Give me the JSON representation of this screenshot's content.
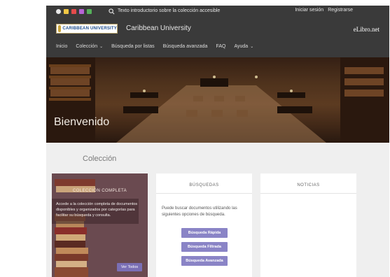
{
  "topbar": {
    "notice": "Texto introductorio sobre la colección accesible",
    "login": "Iniciar sesión",
    "register": "Registrarse"
  },
  "brand": {
    "logo_text": "CARIBBEAN UNIVERSITY",
    "university_name": "Caribbean University",
    "platform_name": "eLibro.net"
  },
  "nav": {
    "items": [
      {
        "label": "Inicio",
        "dropdown": false
      },
      {
        "label": "Colección",
        "dropdown": true
      },
      {
        "label": "Búsqueda por listas",
        "dropdown": false
      },
      {
        "label": "Búsqueda avanzada",
        "dropdown": false
      },
      {
        "label": "FAQ",
        "dropdown": false
      },
      {
        "label": "Ayuda",
        "dropdown": true
      }
    ]
  },
  "hero": {
    "welcome": "Bienvenido"
  },
  "main": {
    "section_title": "Colección"
  },
  "cards": {
    "collection": {
      "title": "COLECCIÓN COMPLETA",
      "description": "Accede a la colección completa de documentos disponibles y organizados por categorías para facilitar su búsqueda y consulta.",
      "button": "Ver Todos"
    },
    "searches": {
      "title": "BÚSQUEDAS",
      "description": "Puede buscar documentos utilizando las siguientes opciones de búsqueda.",
      "buttons": [
        "Búsqueda Rápida",
        "Búsqueda Filtrada",
        "Búsqueda Avanzada"
      ]
    },
    "news": {
      "title": "NOTICIAS"
    }
  },
  "colors": {
    "header_bg": "#3a3a3a",
    "page_bg": "#efefef",
    "button_purple": "#8a84c6",
    "card_collection_bg": "#6a4a50"
  }
}
